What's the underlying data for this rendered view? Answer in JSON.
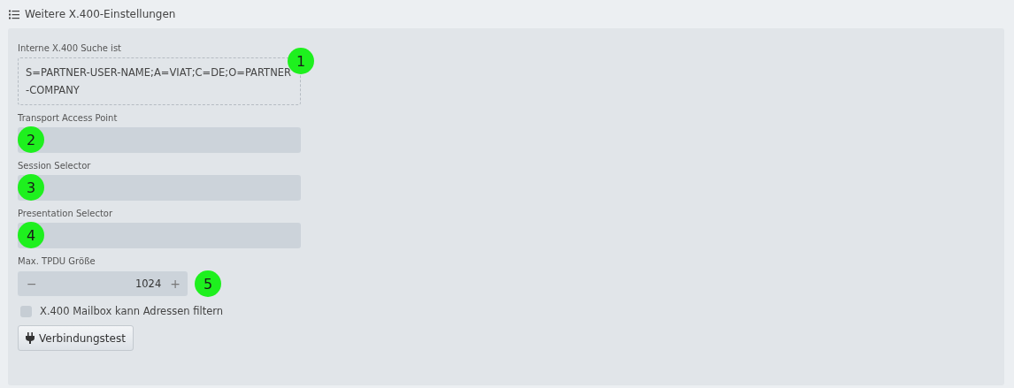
{
  "section": {
    "title": "Weitere X.400-Einstellungen"
  },
  "fields": [
    {
      "kind": "readonly",
      "label": "Interne X.400 Suche ist",
      "value": "S=PARTNER-USER-NAME;A=VIAT;C=DE;O=PARTNER-COMPANY",
      "marker": "1"
    },
    {
      "kind": "text",
      "label": "Transport Access Point",
      "marker": "2"
    },
    {
      "kind": "text",
      "label": "Session Selector",
      "marker": "3"
    },
    {
      "kind": "text",
      "label": "Presentation Selector",
      "marker": "4"
    },
    {
      "kind": "stepper",
      "label": "Max. TPDU Größe",
      "value": "1024",
      "decrement": "−",
      "increment": "+",
      "marker": "5"
    }
  ],
  "checkbox": {
    "label": "X.400 Mailbox kann Adressen filtern",
    "checked": false
  },
  "button": {
    "label": "Verbindungstest"
  }
}
